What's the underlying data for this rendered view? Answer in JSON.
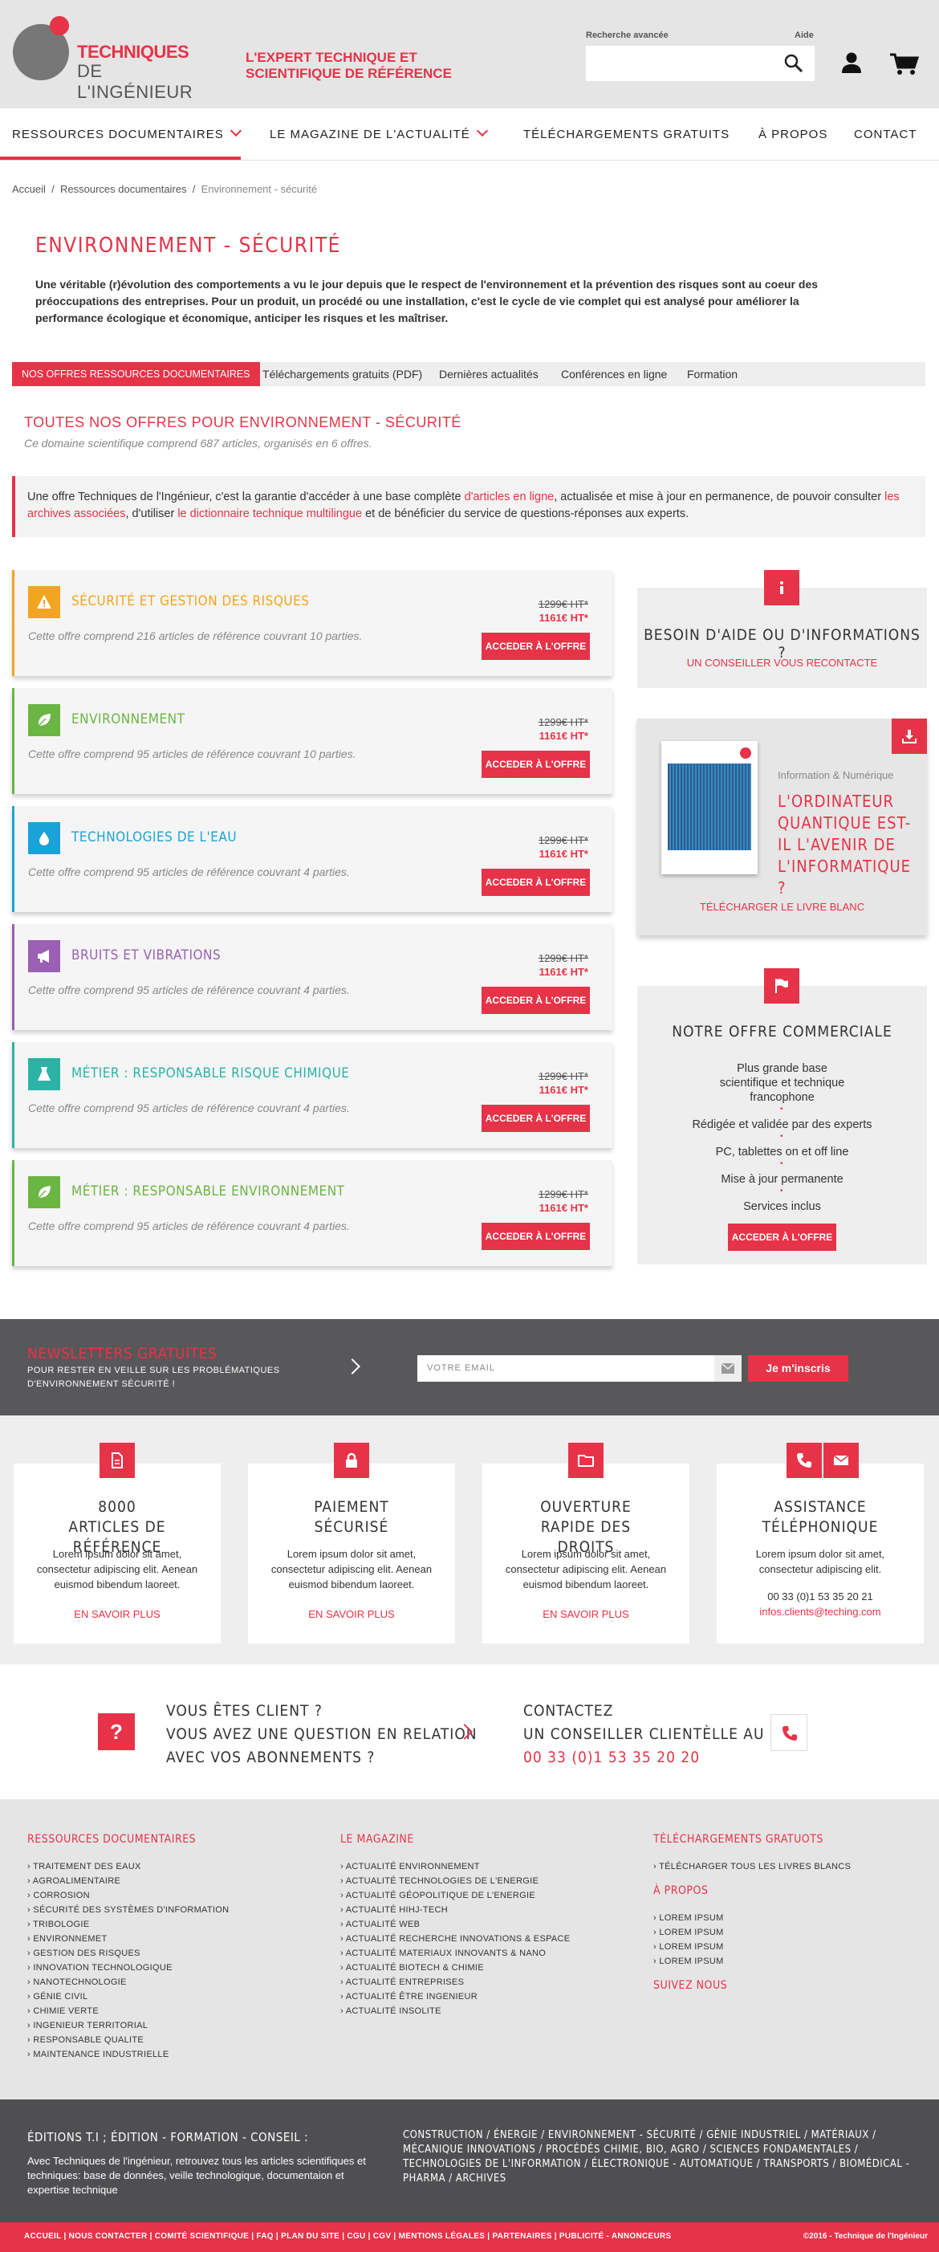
{
  "header": {
    "logo_line1": "TECHNIQUES",
    "logo_line2": "DE L'INGÉNIEUR",
    "tagline": "L'EXPERT TECHNIQUE ET SCIENTIFIQUE DE RÉFÉRENCE",
    "search_label": "Recherche avancée",
    "help_label": "Aide",
    "search_placeholder": ""
  },
  "nav": {
    "items": [
      "RESSOURCES DOCUMENTAIRES",
      "LE MAGAZINE DE L'ACTUALITÉ",
      "TÉLÉCHARGEMENTS GRATUITS",
      "À PROPOS",
      "CONTACT"
    ]
  },
  "breadcrumb": [
    "Accueil",
    "Ressources documentaires",
    "Environnement - sécurité"
  ],
  "page": {
    "title": "ENVIRONNEMENT - SÉCURITÉ",
    "intro": "Une véritable (r)évolution des comportements a vu le jour depuis que le respect de l'environnement et la prévention des risques sont au coeur des préoccupations des entreprises. Pour un produit, un procédé ou une installation, c'est le cycle de vie complet qui est analysé pour améliorer la performance écologique et économique, anticiper les risques et les maîtriser."
  },
  "tabs": [
    "NOS OFFRES RESSOURCES DOCUMENTAIRES",
    "Téléchargements gratuits (PDF)",
    "Dernières actualités",
    "Conférences en ligne",
    "Formation"
  ],
  "section": {
    "title": "TOUTES NOS OFFRES POUR ENVIRONNEMENT - SÉCURITÉ",
    "subtitle": "Ce domaine scientifique comprend 687 articles, organisés en 6 offres.",
    "desc_1": "Une offre Techniques de l'Ingénieur, c'est la garantie d'accéder à une base complète ",
    "desc_link1": "d'articles en ligne",
    "desc_2": ", actualisée et mise à jour en permanence, de pouvoir consulter ",
    "desc_link2": "les archives associées",
    "desc_3": ", d'utiliser ",
    "desc_link3": "le dictionnaire technique multilingue",
    "desc_4": " et de bénéficier du service de questions-réponses aux experts."
  },
  "offers": [
    {
      "title": "SÉCURITÉ ET GESTION DES RISQUES",
      "desc": "Cette offre comprend 216 articles de référence couvrant 10 parties.",
      "old_price": "1299€ HT*",
      "new_price": "1161€ HT*",
      "button": "ACCEDER À L'OFFRE",
      "color": "#f2a521",
      "icon": "warning-icon"
    },
    {
      "title": "ENVIRONNEMENT",
      "desc": "Cette offre comprend 95 articles de référence couvrant 10 parties.",
      "old_price": "1299€ HT*",
      "new_price": "1161€ HT*",
      "button": "ACCEDER À L'OFFRE",
      "color": "#6bb543",
      "icon": "leaf-icon"
    },
    {
      "title": "TECHNOLOGIES DE L'EAU",
      "desc": "Cette offre comprend 95 articles de référence couvrant 4 parties.",
      "old_price": "1299€ HT*",
      "new_price": "1161€ HT*",
      "button": "ACCEDER À L'OFFRE",
      "color": "#1aa3d8",
      "icon": "water-drop-icon"
    },
    {
      "title": "BRUITS ET VIBRATIONS",
      "desc": "Cette offre comprend 95 articles de référence couvrant 4 parties.",
      "old_price": "1299€ HT*",
      "new_price": "1161€ HT*",
      "button": "ACCEDER À L'OFFRE",
      "color": "#9b5fb5",
      "icon": "megaphone-icon"
    },
    {
      "title": "MÉTIER : RESPONSABLE RISQUE CHIMIQUE",
      "desc": "Cette offre comprend 95 articles de référence couvrant 4 parties.",
      "old_price": "1299€ HT*",
      "new_price": "1161€ HT*",
      "button": "ACCEDER À L'OFFRE",
      "color": "#2cb3a6",
      "icon": "flask-icon"
    },
    {
      "title": "MÉTIER : RESPONSABLE ENVIRONNEMENT",
      "desc": "Cette offre comprend 95 articles de référence couvrant 4 parties.",
      "old_price": "1299€ HT*",
      "new_price": "1161€ HT*",
      "button": "ACCEDER À L'OFFRE",
      "color": "#6bb543",
      "icon": "leaf-icon"
    }
  ],
  "help": {
    "title": "BESOIN D'AIDE OU D'INFORMATIONS ?",
    "link": "UN CONSEILLER VOUS RECONTACTE"
  },
  "whitepaper": {
    "category": "Information & Numérique",
    "title": "L'ORDINATEUR QUANTIQUE EST-IL L'AVENIR DE L'INFORMATIQUE ?",
    "link": "TÉLÉCHARGER LE LIVRE BLANC"
  },
  "commercial": {
    "title": "NOTRE OFFRE COMMERCIALE",
    "items": [
      "Plus grande base scientifique et technique francophone",
      "Rédigée et validée par des experts",
      "PC, tablettes on et off line",
      "Mise à jour permanente",
      "Services inclus"
    ],
    "button": "ACCEDER À L'OFFRE"
  },
  "newsletter": {
    "title": "NEWSLETTERS GRATUITES",
    "subtitle": "POUR RESTER EN VEILLE SUR LES PROBLÉMATIQUES D'ENVIRONNEMENT SÉCURITÉ !",
    "placeholder": "VOTRE EMAIL",
    "button": "Je m'inscris"
  },
  "features": [
    {
      "title": "8000 ARTICLES DE RÉFÉRENCE",
      "desc": "Lorem ipsum dolor sit amet, consectetur adipiscing elit. Aenean euismod bibendum laoreet.",
      "link": "EN SAVOIR PLUS",
      "icon": "document-icon"
    },
    {
      "title": "PAIEMENT SÉCURISÉ",
      "desc": "Lorem ipsum dolor sit amet, consectetur adipiscing elit. Aenean euismod bibendum laoreet.",
      "link": "EN SAVOIR PLUS",
      "icon": "lock-icon"
    },
    {
      "title": "OUVERTURE RAPIDE DES DROITS",
      "desc": "Lorem ipsum dolor sit amet, consectetur adipiscing elit. Aenean euismod bibendum laoreet.",
      "link": "EN SAVOIR PLUS",
      "icon": "folder-icon"
    },
    {
      "title": "ASSISTANCE TÉLÉPHONIQUE",
      "desc": "Lorem ipsum dolor sit amet, consectetur adipiscing elit.",
      "phone": "00 33 (0)1 53 35 20 21",
      "email": "infos.clients@teching.com",
      "icon": "phone-icon"
    }
  ],
  "client": {
    "q_line1": "VOUS ÊTES CLIENT ?",
    "q_line2": "VOUS AVEZ UNE QUESTION EN RELATION",
    "q_line3": "AVEC VOS ABONNEMENTS ?",
    "c_line1": "CONTACTEZ",
    "c_line2": "UN CONSEILLER CLIENTÈLLE AU",
    "phone": "00 33 (0)1 53 35 20 20"
  },
  "footer": {
    "col1": {
      "title": "RESSOURCES DOCUMENTAIRES",
      "items": [
        "› TRAITEMENT DES EAUX",
        "› AGROALIMENTAIRE",
        "› CORROSION",
        "› SÉCURITÉ DES SYSTÈMES D'INFORMATION",
        "› TRIBOLOGIE",
        "› ENVIRONNEMET",
        "› GESTION DES RISQUES",
        "› INNOVATION TECHNOLOGIQUE",
        "› NANOTECHNOLOGIE",
        "› GÉNIE CIVIL",
        "› CHIMIE VERTE",
        "› INGENIEUR TERRITORIAL",
        "› RESPONSABLE QUALITE",
        "› MAINTENANCE INDUSTRIELLE"
      ]
    },
    "col2": {
      "title": "LE MAGAZINE",
      "items": [
        "› ACTUALITÉ ENVIRONNEMENT",
        "› ACTUALITÉ TECHNOLOGIES DE L'ENERGIE",
        "› ACTUALITÉ GÉOPOLITIQUE DE L'ENERGIE",
        "› ACTUALITÉ HIHJ-TECH",
        "› ACTUALITÉ WEB",
        "› ACTUALITÉ RECHERCHE INNOVATIONS & ESPACE",
        "› ACTUALITÉ MATERIAUX INNOVANTS & NANO",
        "› ACTUALITÉ BIOTECH & CHIMIE",
        "› ACTUALITÉ ENTREPRISES",
        "› ACTUALITÉ ÊTRE INGENIEUR",
        "› ACTUALITÉ INSOLITE"
      ]
    },
    "col3": {
      "title": "TÉLÉCHARGEMENTS GRATUOTS",
      "items": [
        "› TÉLÉCHARGER TOUS LES LIVRES BLANCS"
      ],
      "title2": "À PROPOS",
      "items2": [
        "› LOREM IPSUM",
        "› LOREM IPSUM",
        "› LOREM IPSUM",
        "› LOREM IPSUM"
      ],
      "title3": "SUIVEZ NOUS"
    },
    "editions_title": "ÉDITIONS T.I ; ÉDITION - FORMATION - CONSEIL :",
    "editions_desc": "Avec Techniques de l'ingénieur, retrouvez tous les articles scientifiques et techniques: base de données, veille technologique, documentaion et expertise technique",
    "tags": "CONSTRUCTION / ÉNERGIE / ENVIRONNEMENT - SÉCURITÉ / GÉNIE INDUSTRIEL / MATÉRIAUX / MÉCANIQUE INNOVATIONS / PROCÉDÉS CHIMIE, BIO, AGRO / SCIENCES FONDAMENTALES / TECHNOLOGIES DE L'INFORMATION / ÉLECTRONIQUE - AUTOMATIQUE / TRANSPORTS / BIOMÉDICAL - PHARMA / ARCHIVES",
    "bottom_links": "ACCUEIL | NOUS CONTACTER | COMITÉ SCIENTIFIQUE | FAQ | PLAN DU SITE | CGU | CGV | MENTIONS LÉGALES | PARTENAIRES | PUBLICITÉ - ANNONCEURS",
    "copyright": "©2016 - Technique de l'Ingénieur"
  },
  "colors": {
    "accent": "#e63347",
    "dark": "#58575a",
    "light": "#eeeeee"
  }
}
